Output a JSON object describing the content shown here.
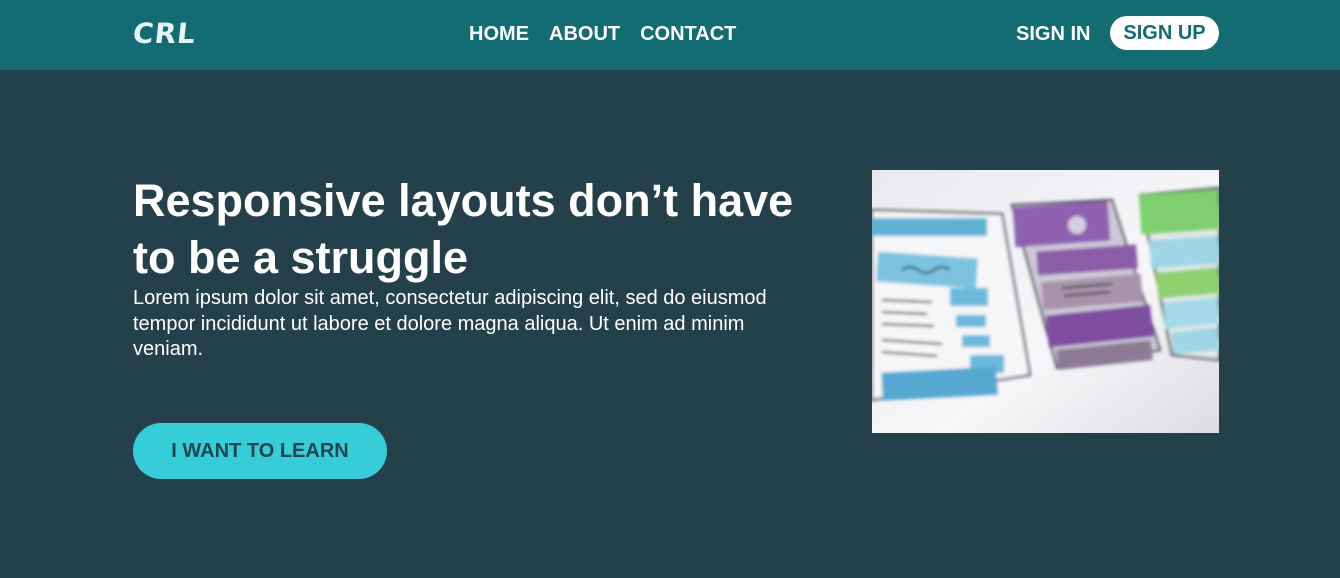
{
  "header": {
    "logo": "CRL",
    "nav": [
      {
        "label": "HOME"
      },
      {
        "label": "ABOUT"
      },
      {
        "label": "CONTACT"
      }
    ],
    "sign_in": "SIGN IN",
    "sign_up": "SIGN UP"
  },
  "hero": {
    "title": "Responsive layouts don’t have to be a struggle",
    "text": "Lorem ipsum dolor sit amet, consectetur adipiscing elit, sed do eiusmod tempor incididunt ut labore et dolore magna aliqua. Ut enim ad minim veniam.",
    "cta_label": "I WANT TO LEARN",
    "image_icon": "wireframe-sketch-image"
  },
  "colors": {
    "header_bg": "#136c72",
    "page_bg": "#24414b",
    "cta_bg": "#36cdd9",
    "sign_up_text": "#136c72"
  }
}
